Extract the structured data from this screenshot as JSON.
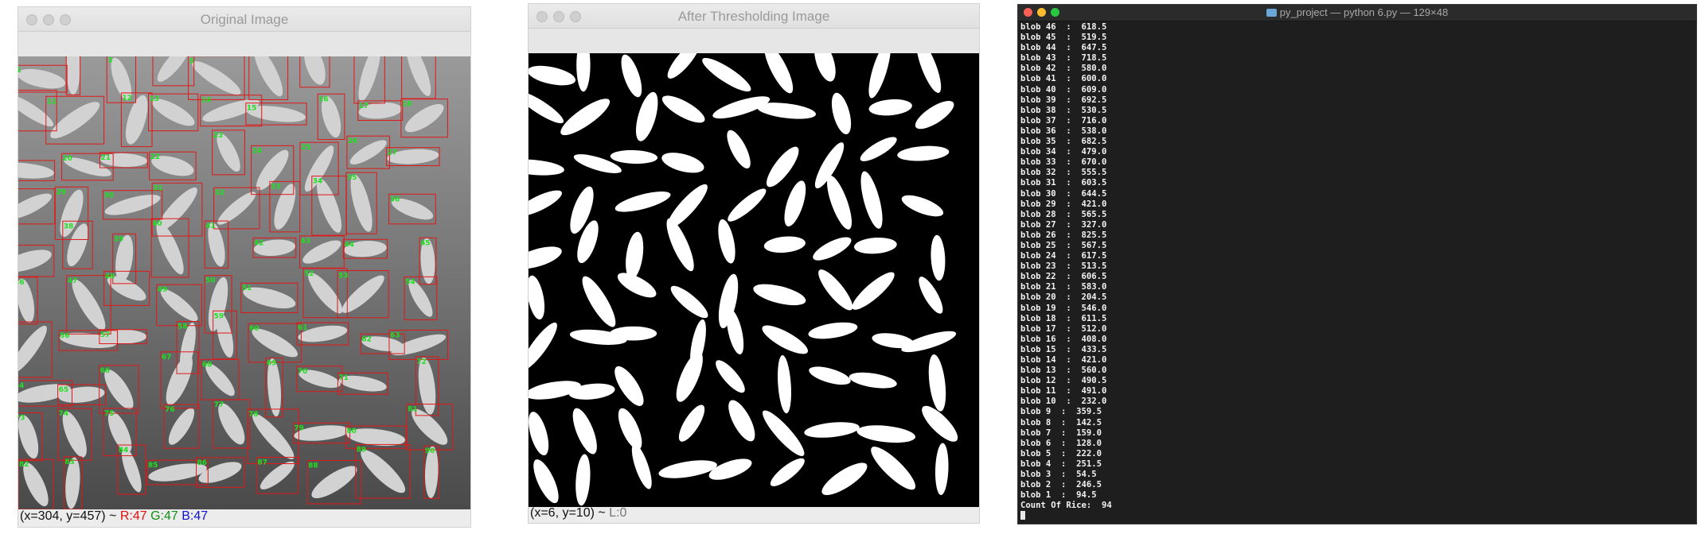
{
  "windows": {
    "original": {
      "title": "Original Image",
      "status": {
        "coords": "(x=304, y=457) ~ ",
        "r": "R:47",
        "g": "G:47",
        "b": "B:47"
      }
    },
    "threshold": {
      "title": "After Thresholding Image",
      "status": {
        "coords": "(x=6, y=10) ~ ",
        "l": "L:0"
      }
    }
  },
  "terminal": {
    "title": "py_project — python 6.py — 129×48",
    "lines": [
      "blob 46  :  618.5",
      "blob 45  :  519.5",
      "blob 44  :  647.5",
      "blob 43  :  718.5",
      "blob 42  :  580.0",
      "blob 41  :  600.0",
      "blob 40  :  609.0",
      "blob 39  :  692.5",
      "blob 38  :  530.5",
      "blob 37  :  716.0",
      "blob 36  :  538.0",
      "blob 35  :  682.5",
      "blob 34  :  479.0",
      "blob 33  :  670.0",
      "blob 32  :  555.5",
      "blob 31  :  603.5",
      "blob 30  :  644.5",
      "blob 29  :  421.0",
      "blob 28  :  565.5",
      "blob 27  :  327.0",
      "blob 26  :  825.5",
      "blob 25  :  567.5",
      "blob 24  :  617.5",
      "blob 23  :  513.5",
      "blob 22  :  606.5",
      "blob 21  :  583.0",
      "blob 20  :  204.5",
      "blob 19  :  546.0",
      "blob 18  :  611.5",
      "blob 17  :  512.0",
      "blob 16  :  408.0",
      "blob 15  :  433.5",
      "blob 14  :  421.0",
      "blob 13  :  560.0",
      "blob 12  :  490.5",
      "blob 11  :  491.0",
      "blob 10  :  232.0",
      "blob 9  :  359.5",
      "blob 8  :  142.5",
      "blob 7  :  159.0",
      "blob 6  :  128.0",
      "blob 5  :  222.0",
      "blob 4  :  251.5",
      "blob 3  :  54.5",
      "blob 2  :  246.5",
      "blob 1  :  94.5",
      "Count Of Rice:  94"
    ]
  },
  "blob_labels": [
    "1",
    "2",
    "3",
    "4",
    "5",
    "6",
    "7",
    "8",
    "9",
    "10",
    "11",
    "12",
    "13",
    "14",
    "15",
    "16",
    "17",
    "18",
    "19",
    "20",
    "21",
    "22",
    "23",
    "24",
    "25",
    "26",
    "27",
    "28",
    "29",
    "30",
    "31",
    "32",
    "33",
    "34",
    "35",
    "36",
    "37",
    "38",
    "39",
    "40",
    "41",
    "42",
    "43",
    "44",
    "45",
    "46",
    "47",
    "48",
    "49",
    "50",
    "51",
    "52",
    "53",
    "54",
    "55",
    "56",
    "57",
    "58",
    "59",
    "60",
    "61",
    "62",
    "63",
    "64",
    "65",
    "66",
    "67",
    "68",
    "69",
    "70",
    "71",
    "72",
    "73",
    "74",
    "75",
    "76",
    "77",
    "78",
    "79",
    "80",
    "81",
    "82",
    "83",
    "84",
    "85",
    "86",
    "87",
    "88",
    "89",
    "90",
    "91",
    "92",
    "93",
    "94"
  ],
  "colors": {
    "box": "#e01818",
    "label": "#1ee01e",
    "grain_gray": "#d2d2d2",
    "grain_white": "#ffffff"
  }
}
